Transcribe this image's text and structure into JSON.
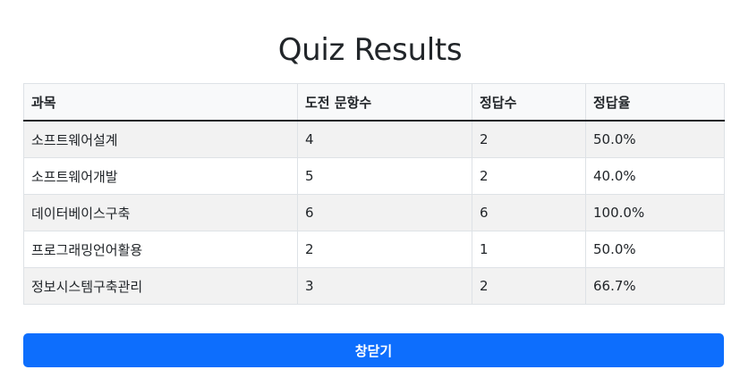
{
  "page": {
    "title": "Quiz Results"
  },
  "table": {
    "headers": [
      "과목",
      "도전 문항수",
      "정답수",
      "정답율"
    ],
    "rows": [
      [
        "소프트웨어설계",
        "4",
        "2",
        "50.0%"
      ],
      [
        "소프트웨어개발",
        "5",
        "2",
        "40.0%"
      ],
      [
        "데이터베이스구축",
        "6",
        "6",
        "100.0%"
      ],
      [
        "프로그래밍언어활용",
        "2",
        "1",
        "50.0%"
      ],
      [
        "정보시스템구축관리",
        "3",
        "2",
        "66.7%"
      ]
    ]
  },
  "actions": {
    "close_label": "창닫기"
  },
  "colors": {
    "accent": "#0d6efd",
    "striped_row": "#f2f2f2",
    "header_bg": "#f8f9fa"
  }
}
